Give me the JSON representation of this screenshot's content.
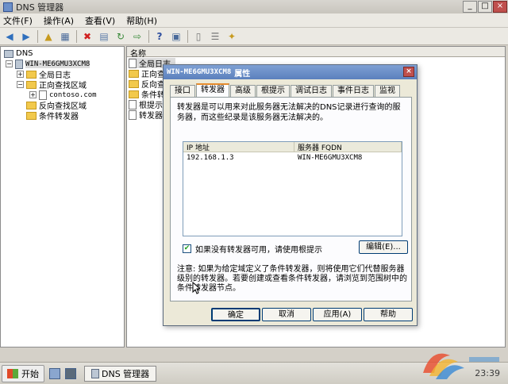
{
  "window": {
    "title": "DNS 管理器"
  },
  "menu": [
    "文件(F)",
    "操作(A)",
    "查看(V)",
    "帮助(H)"
  ],
  "tree": {
    "root": "DNS",
    "server": "WIN-ME6GMU3XCM8",
    "items": [
      "全局日志",
      "正向查找区域",
      "contoso.com",
      "反向查找区域",
      "条件转发器"
    ]
  },
  "list": {
    "header": "名称",
    "items": [
      "全局日志",
      "正向查",
      "反向查",
      "条件转",
      "根提示",
      "转发器"
    ]
  },
  "dialog": {
    "title_server": "WIN-ME6GMU3XCM8",
    "title_suffix": "属性",
    "tabs": [
      "接口",
      "转发器",
      "高级",
      "根提示",
      "调试日志",
      "事件日志",
      "监视"
    ],
    "description": "转发器是可以用来对此服务器无法解决的DNS记录进行查询的服务器，而这些纪录是该服务器无法解决的。",
    "columns": [
      "IP 地址",
      "服务器 FQDN"
    ],
    "rows": [
      {
        "ip": "192.168.1.3",
        "fqdn": "WIN-ME6GMU3XCM8"
      }
    ],
    "checkbox_label": "如果没有转发器可用，请使用根提示",
    "edit_button": "编辑(E)...",
    "note": "注意: 如果为给定域定义了条件转发器，则将使用它们代替服务器级别的转发器。若要创建或查看条件转发器，请浏览到范围树中的条件转发器节点。",
    "buttons": {
      "ok": "确定",
      "cancel": "取消",
      "apply": "应用(A)",
      "help": "帮助"
    }
  },
  "taskbar": {
    "start": "开始",
    "task": "DNS 管理器",
    "clock": "23:39"
  }
}
